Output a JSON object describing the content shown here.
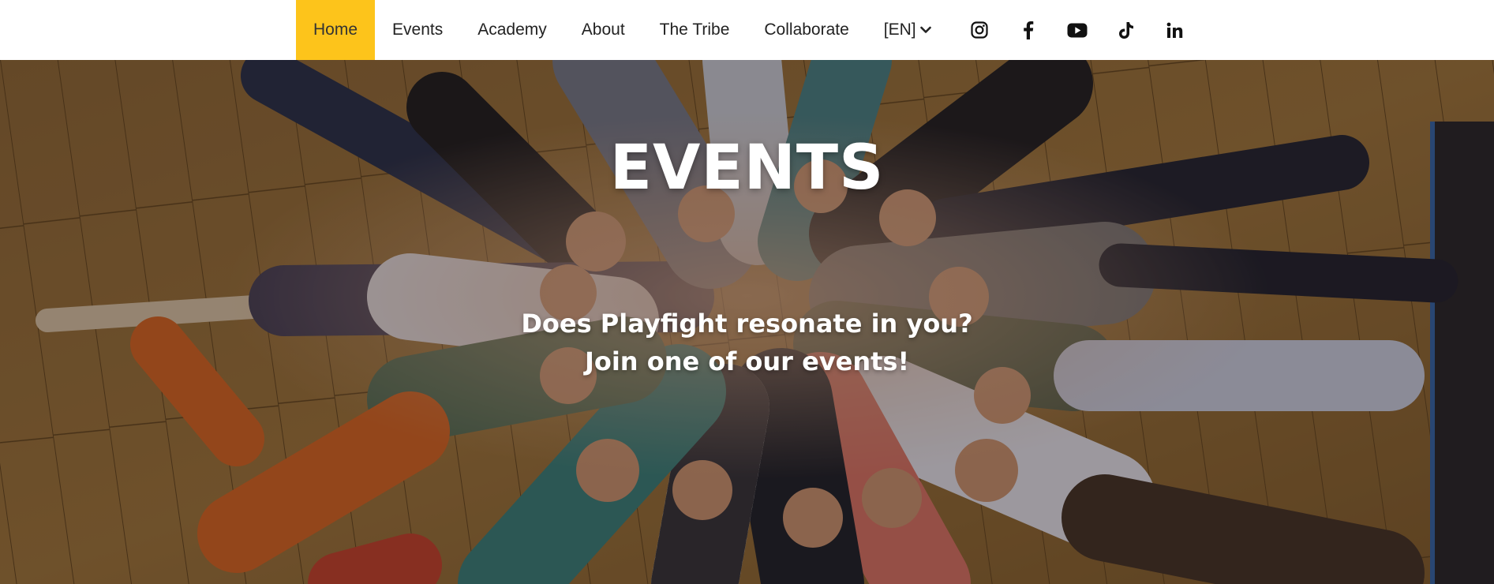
{
  "nav": {
    "items": [
      {
        "label": "Home",
        "active": true
      },
      {
        "label": "Events",
        "active": false
      },
      {
        "label": "Academy",
        "active": false
      },
      {
        "label": "About",
        "active": false
      },
      {
        "label": "The Tribe",
        "active": false
      },
      {
        "label": "Collaborate",
        "active": false
      }
    ],
    "language": "[EN]",
    "social_icons": [
      "instagram-icon",
      "facebook-icon",
      "youtube-icon",
      "tiktok-icon",
      "linkedin-icon"
    ]
  },
  "hero": {
    "title": "EVENTS",
    "subtitle_line1": "Does Playfight resonate in you?",
    "subtitle_line2": "Join one of our events!"
  },
  "colors": {
    "accent": "#fdc41b",
    "nav_text": "#222222",
    "hero_text": "#ffffff",
    "floor": "#7a5624"
  }
}
